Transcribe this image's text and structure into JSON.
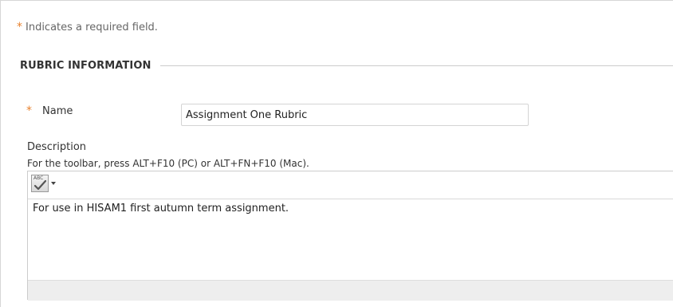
{
  "required_note": {
    "star": "*",
    "text": "Indicates a required field."
  },
  "section": {
    "title": "RUBRIC INFORMATION"
  },
  "name_field": {
    "star": "*",
    "label": "Name",
    "value": "Assignment One Rubric"
  },
  "description": {
    "label": "Description",
    "toolbar_hint": "For the toolbar, press ALT+F10 (PC) or ALT+FN+F10 (Mac).",
    "content": "For use in HISAM1 first autumn term assignment."
  },
  "editor_toolbar": {
    "spellcheck_icon": "spellcheck-abc-icon",
    "spellcheck_abc": "ABC",
    "dropdown_icon": "chevron-down-icon"
  },
  "colors": {
    "required_star": "#e8822e",
    "text": "#333333",
    "rule": "#cccccc",
    "status_bar": "#eeeeee"
  }
}
